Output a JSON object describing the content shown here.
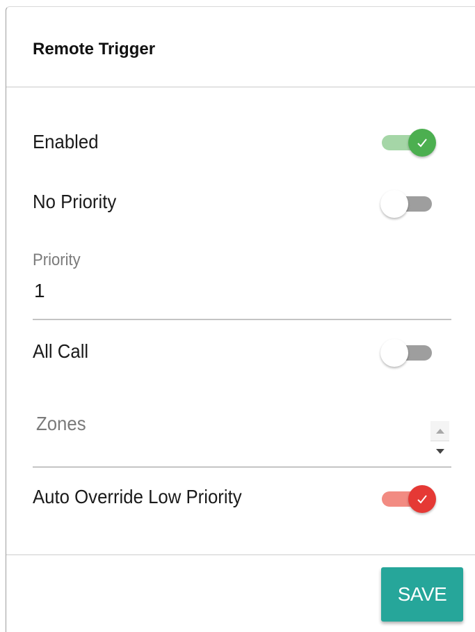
{
  "dialog": {
    "title": "Remote Trigger"
  },
  "settings": {
    "enabled": {
      "label": "Enabled",
      "checked": true,
      "color": "#4caf50",
      "track_color": "#a5d6a7"
    },
    "no_priority": {
      "label": "No Priority",
      "checked": false
    },
    "priority": {
      "label": "Priority",
      "value": "1"
    },
    "all_call": {
      "label": "All Call",
      "checked": false
    },
    "zones": {
      "placeholder": "Zones",
      "value": ""
    },
    "auto_override": {
      "label": "Auto Override Low Priority",
      "checked": true,
      "color": "#e53935",
      "track_color": "#f28b82"
    }
  },
  "footer": {
    "save_label": "SAVE",
    "save_color": "#26a69a"
  }
}
